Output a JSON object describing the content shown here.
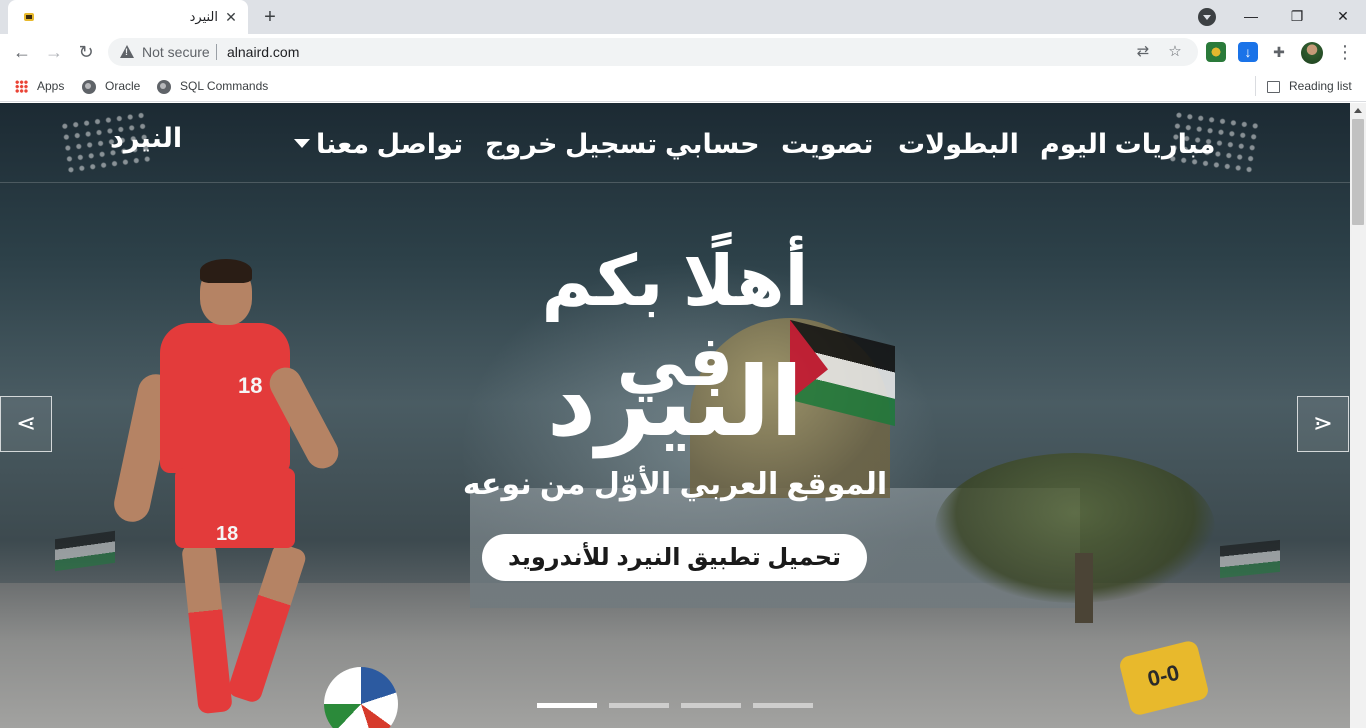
{
  "browser": {
    "tab_title": "النيرد",
    "tab_close": "✕",
    "new_tab": "+",
    "window_buttons": {
      "minimize": "—",
      "restore": "❐",
      "close": "✕"
    },
    "security_label": "Not secure",
    "url": "alnaird.com",
    "bookmarks": [
      "Apps",
      "Oracle",
      "SQL Commands"
    ],
    "reading_list": "Reading list",
    "icons": [
      "back-icon",
      "forward-icon",
      "reload-icon",
      "warning-icon",
      "translate-icon",
      "star-icon",
      "extension-icon",
      "download-icon",
      "puzzle-icon",
      "avatar",
      "menu-icon"
    ]
  },
  "site": {
    "brand": "النيرد",
    "nav": {
      "today_matches": "مباريات اليوم",
      "tournaments": "البطولات",
      "vote": "تصويت",
      "my_account": "حسابي",
      "logout": "تسجيل خروج",
      "contact": "تواصل معنا"
    }
  },
  "hero": {
    "welcome": "أهلًا بكم في",
    "brand": "النيرد",
    "subtitle": "الموقع العربي الأوّل من نوعه",
    "cta": "تحميل تطبيق النيرد للأندرويد",
    "prev_arrow": "⋖",
    "next_arrow": "⋗",
    "slides_count": 4,
    "active_slide": 1,
    "player_number": "18",
    "badge_text": "0-0"
  },
  "colors": {
    "jersey": "#e33b3b",
    "chrome": "#dee1e6",
    "text": "#ffffff"
  }
}
